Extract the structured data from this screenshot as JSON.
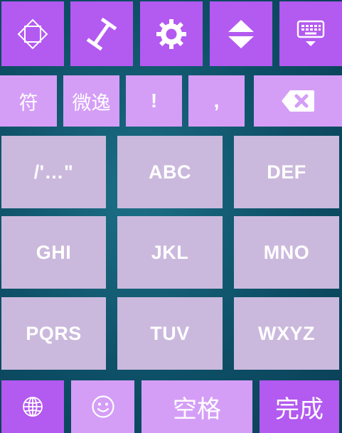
{
  "toolbar": {
    "icons": [
      "crop-icon",
      "cursor-move-icon",
      "settings-gear-icon",
      "up-down-arrows-icon",
      "hide-keyboard-icon"
    ]
  },
  "symbol_row": {
    "symbols_key": "符",
    "phrase_key": "微逸",
    "exclaim_key": "!",
    "comma_key": ",",
    "delete_icon": "backspace-icon"
  },
  "keypad": {
    "rows": [
      [
        "/'…\"",
        "ABC",
        "DEF"
      ],
      [
        "GHI",
        "JKL",
        "MNO"
      ],
      [
        "PQRS",
        "TUV",
        "WXYZ"
      ]
    ]
  },
  "bottom_row": {
    "globe_icon": "globe-icon",
    "emoji_icon": "smiley-icon",
    "space_label": "空格",
    "done_label": "完成"
  },
  "colors": {
    "background": "#0d4f66",
    "function_key": "#b35af0",
    "function_key_light": "#d49ef7",
    "letter_key": "#cbb9dd",
    "text": "#ffffff"
  }
}
